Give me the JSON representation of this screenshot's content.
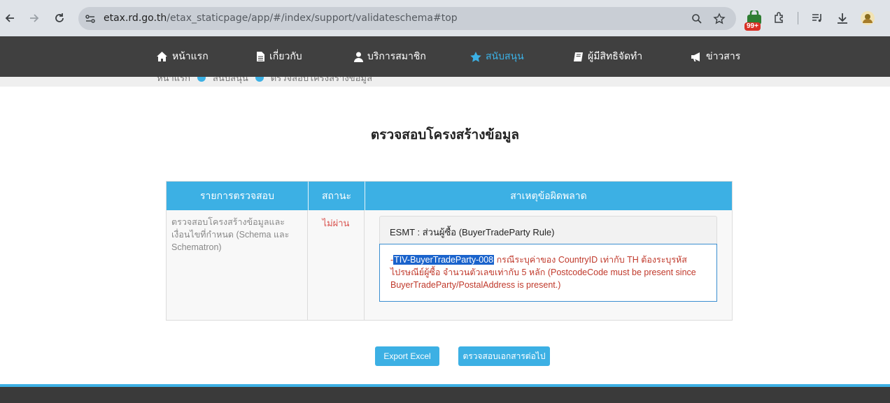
{
  "browser": {
    "url_host": "etax.rd.go.th",
    "url_path": "/etax_staticpage/app/#/index/support/validateschema#top",
    "extension_badge": "99+"
  },
  "nav": {
    "items": [
      {
        "label": "หน้าแรก",
        "icon": "home-icon"
      },
      {
        "label": "เกี่ยวกับ",
        "icon": "document-icon"
      },
      {
        "label": "บริการสมาชิก",
        "icon": "user-icon"
      },
      {
        "label": "สนับสนุน",
        "icon": "star-icon",
        "active": true
      },
      {
        "label": "ผู้มีสิทธิจัดทำ",
        "icon": "book-icon"
      },
      {
        "label": "ข่าวสาร",
        "icon": "megaphone-icon"
      }
    ]
  },
  "breadcrumb": [
    "หน้าแรก",
    "สนับสนุน",
    "ตรวจสอบโครงสร้างข้อมูล"
  ],
  "page": {
    "title": "ตรวจสอบโครงสร้างข้อมูล"
  },
  "table": {
    "headers": [
      "รายการตรวจสอบ",
      "สถานะ",
      "สาเหตุข้อผิดพลาด"
    ],
    "row": {
      "item": "ตรวจสอบโครงสร้างข้อมูลและเงื่อนไขที่กำหนด (Schema และ Schematron)",
      "status": "ไม่ผ่าน",
      "error_panel": {
        "heading": "ESMT : ส่วนผู้ซื้อ (BuyerTradeParty Rule)",
        "bullet": "-",
        "code": "TIV-BuyerTradeParty-008",
        "message": " กรณีระบุค่าของ CountryID เท่ากับ TH ต้องระบุรหัสไปรษณีย์ผู้ซื้อ จำนวนตัวเลขเท่ากับ 5 หลัก (PostcodeCode must be present since BuyerTradeParty/PostalAddress is present.)"
      }
    }
  },
  "buttons": {
    "export": "Export Excel",
    "next": "ตรวจสอบเอกสารต่อไป"
  }
}
